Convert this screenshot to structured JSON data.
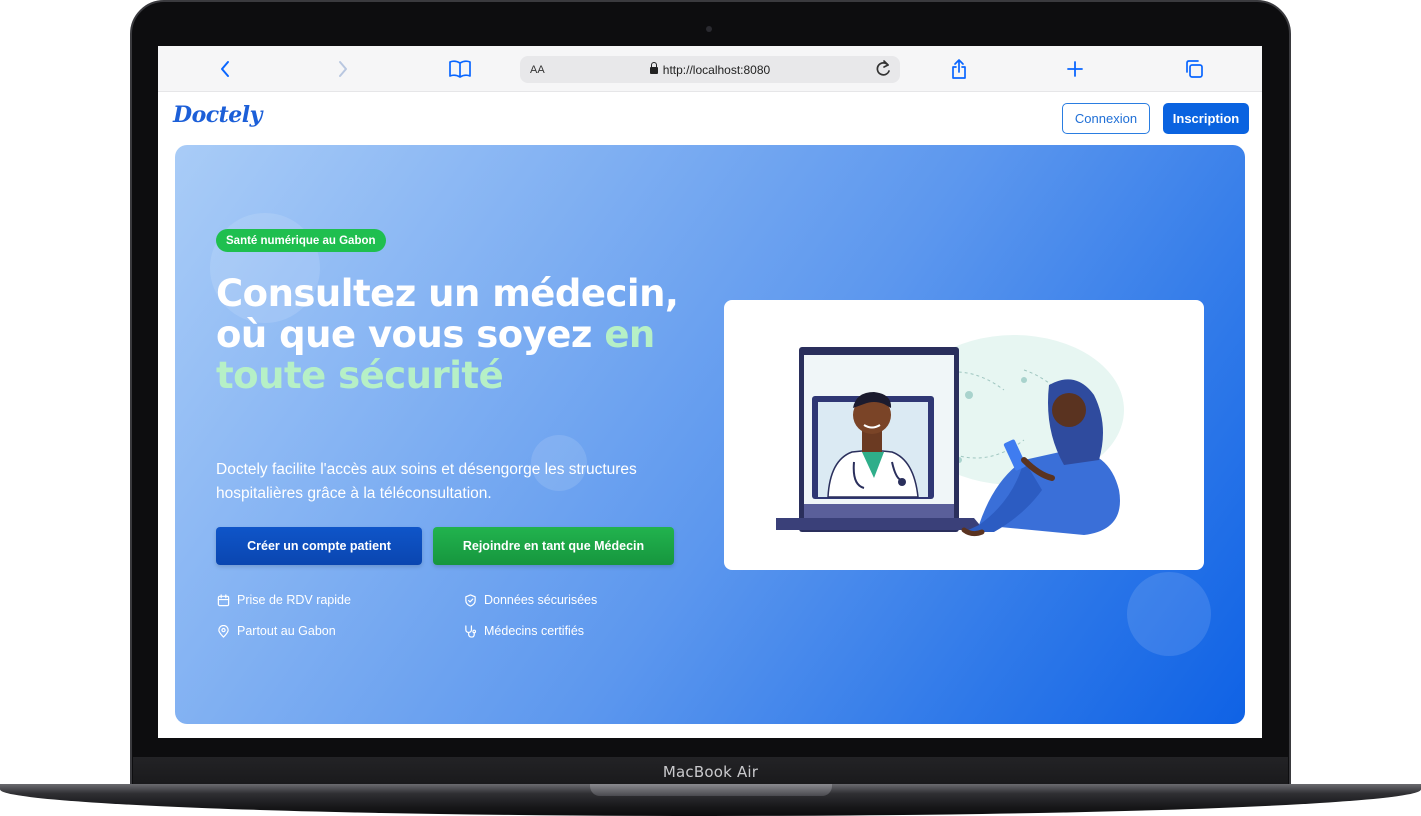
{
  "device": {
    "label": "MacBook Air"
  },
  "browser": {
    "aa_label": "AA",
    "url": "http://localhost:8080"
  },
  "header": {
    "logo": "Doctely",
    "login_label": "Connexion",
    "signup_label": "Inscription"
  },
  "hero": {
    "badge": "Santé numérique au Gabon",
    "headline_main": "Consultez un médecin, où que vous soyez ",
    "headline_highlight": "en toute sécurité",
    "subtitle": "Doctely facilite l'accès aux soins et désengorge les structures hospitalières grâce à la téléconsultation.",
    "cta_patient": "Créer un compte patient",
    "cta_doctor": "Rejoindre en tant que Médecin",
    "features": [
      {
        "icon": "calendar-icon",
        "label": "Prise de RDV rapide"
      },
      {
        "icon": "shield-icon",
        "label": "Données sécurisées"
      },
      {
        "icon": "location-pin-icon",
        "label": "Partout au Gabon"
      },
      {
        "icon": "stethoscope-icon",
        "label": "Médecins certifiés"
      }
    ]
  },
  "colors": {
    "brand_blue": "#0a63e0",
    "accent_green": "#1fbf4f",
    "highlight_green": "#b6f0c6"
  }
}
